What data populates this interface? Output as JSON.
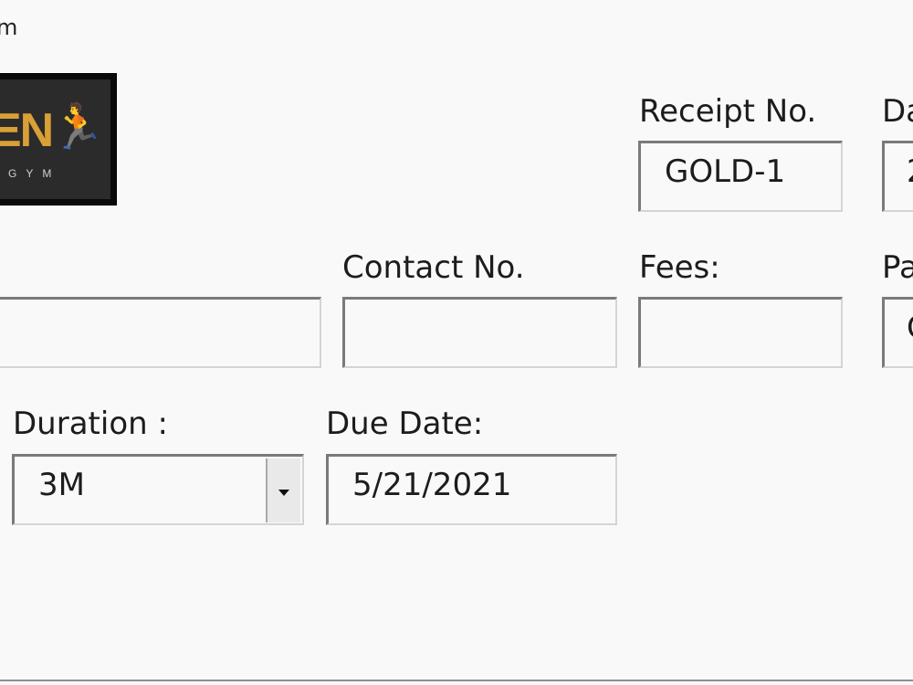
{
  "window": {
    "title_fragment": "m"
  },
  "logo": {
    "text": "EN",
    "subtext": "GYM"
  },
  "receipt": {
    "label": "Receipt No.",
    "value": "GOLD-1"
  },
  "date": {
    "label": "Da",
    "value": "2"
  },
  "name": {
    "value": ""
  },
  "contact": {
    "label": "Contact No.",
    "value": ""
  },
  "fees": {
    "label": "Fees:",
    "value": ""
  },
  "paid": {
    "label": "Pa",
    "value": "C"
  },
  "duration": {
    "label": "Duration :",
    "value": "3M"
  },
  "due_date": {
    "label": "Due Date:",
    "value": "5/21/2021"
  }
}
